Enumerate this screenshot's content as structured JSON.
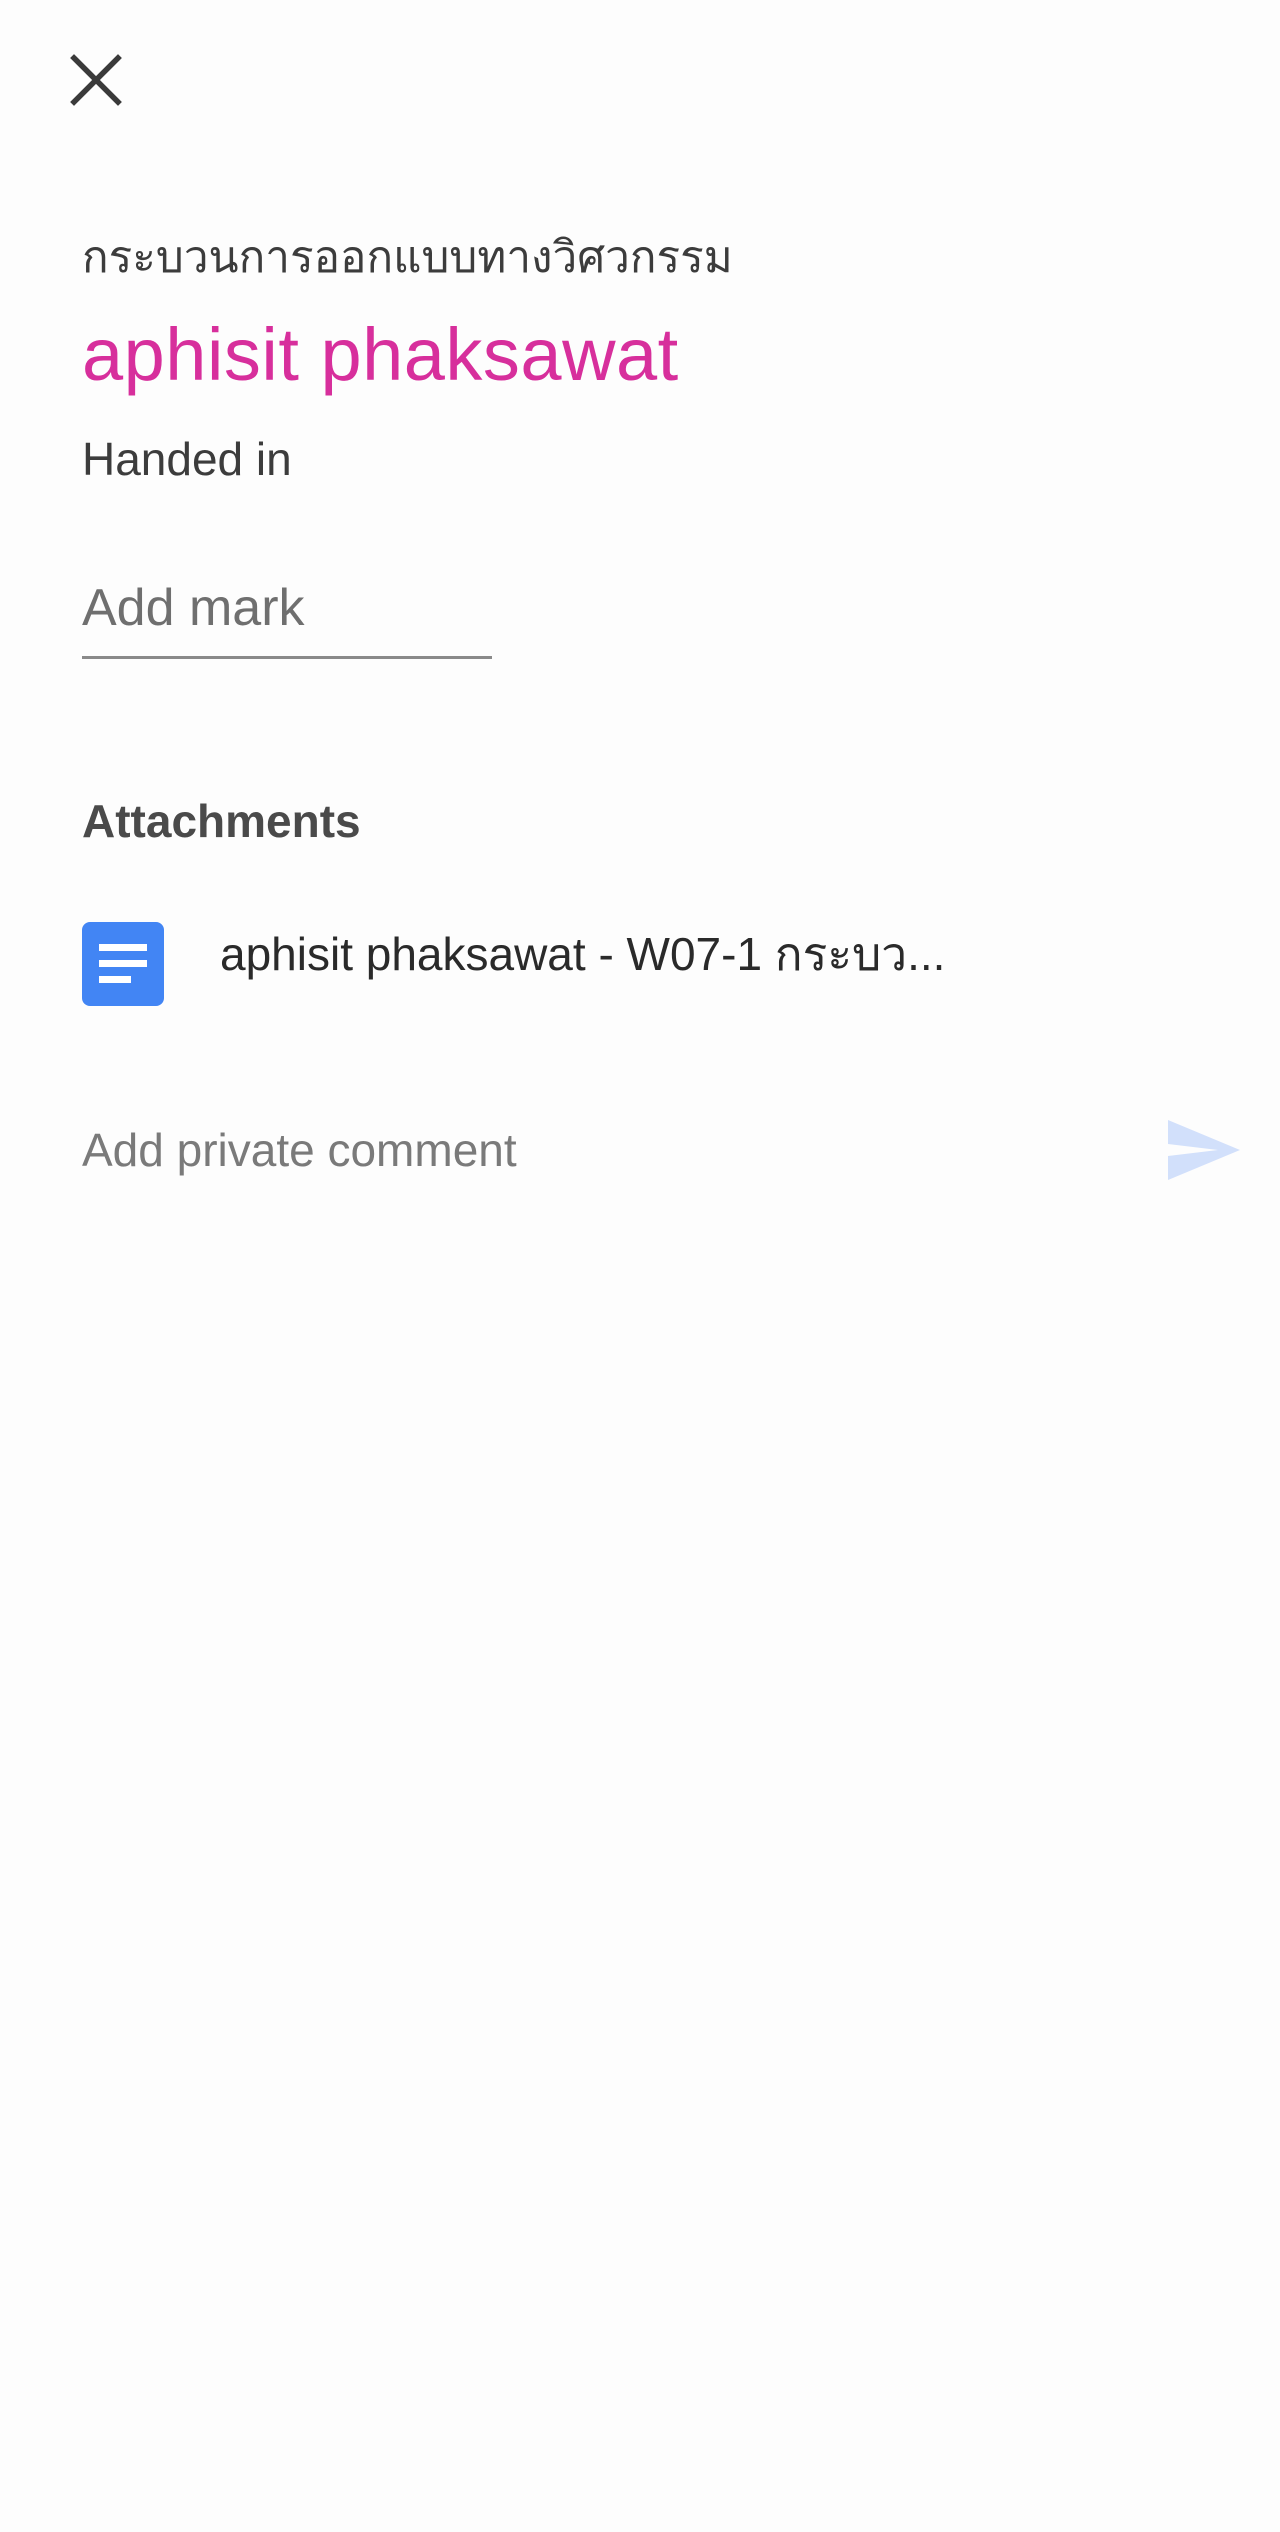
{
  "header": {
    "close_icon": "close-icon"
  },
  "submission": {
    "class_name": "กระบวนการออกแบบทางวิศวกรรม",
    "student_name": "aphisit phaksawat",
    "status": "Handed in",
    "student_name_color": "#d72f9c"
  },
  "mark": {
    "placeholder": "Add mark",
    "value": ""
  },
  "attachments": {
    "heading": "Attachments",
    "items": [
      {
        "icon": "google-docs-icon",
        "title": "aphisit phaksawat - W07-1 กระบว...",
        "icon_color": "#4285f4"
      }
    ]
  },
  "comment": {
    "placeholder": "Add private comment",
    "send_icon": "send-icon",
    "send_color": "#d2e0fb"
  }
}
